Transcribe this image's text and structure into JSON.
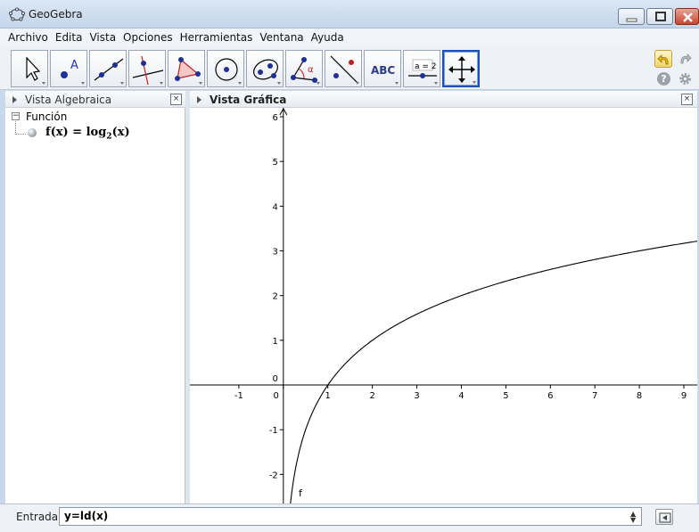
{
  "window": {
    "title": "GeoGebra",
    "minimize_icon": "minimize-icon",
    "maximize_icon": "maximize-icon",
    "close_icon": "close-icon"
  },
  "menu": [
    "Archivo",
    "Edita",
    "Vista",
    "Opciones",
    "Herramientas",
    "Ventana",
    "Ayuda"
  ],
  "toolbar": {
    "tools": [
      {
        "icon": "move-arrow-icon"
      },
      {
        "icon": "point-icon",
        "label": "A"
      },
      {
        "icon": "line-icon"
      },
      {
        "icon": "perpendicular-line-icon"
      },
      {
        "icon": "polygon-icon"
      },
      {
        "icon": "circle-center-point-icon"
      },
      {
        "icon": "ellipse-icon"
      },
      {
        "icon": "angle-icon",
        "label": "α"
      },
      {
        "icon": "reflect-icon"
      },
      {
        "icon": "text-icon",
        "label": "ABC"
      },
      {
        "icon": "slider-icon",
        "label": "a = 2"
      },
      {
        "icon": "move-graphics-view-icon",
        "selected": true
      }
    ],
    "undo_icon": "undo-icon",
    "redo_icon": "redo-icon",
    "help_label": "?",
    "settings_icon": "gear-icon"
  },
  "algebra_view": {
    "title": "Vista Algebraica",
    "close_label": "×",
    "toggle_label": "−",
    "group": "Función",
    "object": {
      "name_part": "f(x)  =  log",
      "base": "2",
      "arg": "(x)"
    }
  },
  "graphics_view": {
    "title": "Vista Gráfica",
    "close_label": "×",
    "curve_label": "f"
  },
  "chart_data": {
    "type": "line",
    "function": "log2(x)",
    "xlim": [
      -2.1,
      9.3
    ],
    "ylim": [
      -2.65,
      6.2
    ],
    "x_ticks": [
      -1,
      0,
      1,
      2,
      3,
      4,
      5,
      6,
      7,
      8,
      9
    ],
    "y_ticks": [
      -2,
      -1,
      0,
      1,
      2,
      3,
      4,
      5,
      6
    ],
    "grid": false,
    "series": [
      {
        "name": "f",
        "color": "#000000"
      }
    ]
  },
  "input_bar": {
    "label": "Entrada:",
    "value": "y=ld(x)",
    "spinner": "▲▼",
    "keyboard_icon": "virtual-keyboard-icon"
  }
}
